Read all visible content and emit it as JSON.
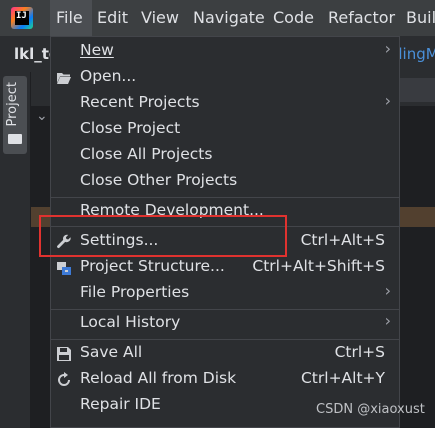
{
  "menubar": {
    "items": [
      "File",
      "Edit",
      "View",
      "Navigate",
      "Code",
      "Refactor",
      "Build"
    ],
    "active": "File"
  },
  "editor": {
    "project_name": "lkl_to",
    "tab_fragment": "dingM",
    "side_tab_label": "Project"
  },
  "file_menu": {
    "items": [
      {
        "label": "New",
        "has_submenu": true
      },
      {
        "label": "Open...",
        "icon": "folder-open-icon"
      },
      {
        "label": "Recent Projects",
        "has_submenu": true
      },
      {
        "label": "Close Project"
      },
      {
        "label": "Close All Projects"
      },
      {
        "label": "Close Other Projects"
      },
      {
        "label": "Remote Development..."
      },
      {
        "label": "Settings...",
        "shortcut": "Ctrl+Alt+S",
        "icon": "wrench-icon"
      },
      {
        "label": "Project Structure...",
        "shortcut": "Ctrl+Alt+Shift+S",
        "icon": "project-structure-icon"
      },
      {
        "label": "File Properties",
        "has_submenu": true
      },
      {
        "label": "Local History",
        "has_submenu": true
      },
      {
        "label": "Save All",
        "shortcut": "Ctrl+S",
        "icon": "save-icon"
      },
      {
        "label": "Reload All from Disk",
        "shortcut": "Ctrl+Alt+Y",
        "icon": "reload-icon"
      },
      {
        "label": "Repair IDE"
      }
    ]
  },
  "watermark": "CSDN @xiaoxust",
  "colors": {
    "background": "#2b2d30",
    "menubar": "#3c3f41",
    "highlight_box": "#e0322f",
    "link_blue": "#4a90d9"
  }
}
